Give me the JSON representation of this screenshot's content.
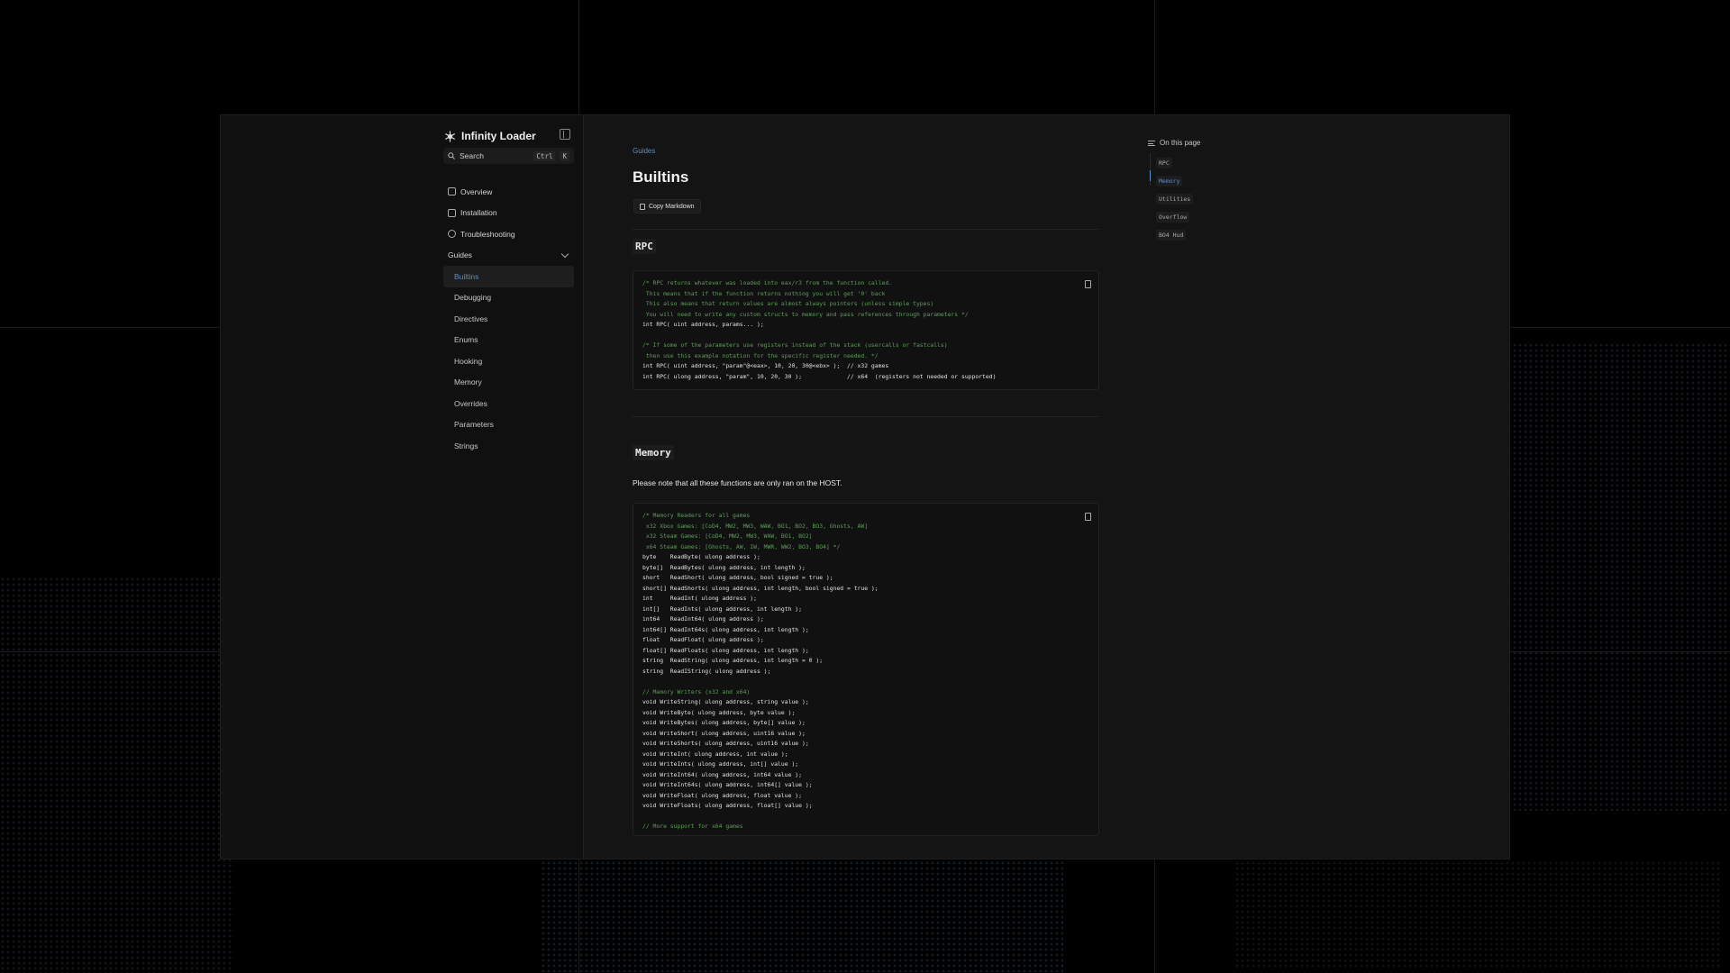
{
  "brand": {
    "name": "Infinity Loader"
  },
  "search": {
    "label": "Search",
    "key1": "Ctrl",
    "key2": "K"
  },
  "nav": {
    "overview": "Overview",
    "installation": "Installation",
    "troubleshooting": "Troubleshooting",
    "guides": "Guides",
    "guide_items": [
      "Builtins",
      "Debugging",
      "Directives",
      "Enums",
      "Hooking",
      "Memory",
      "Overrides",
      "Parameters",
      "Strings"
    ]
  },
  "main": {
    "breadcrumb": "Guides",
    "title": "Builtins",
    "copy_markdown": "Copy Markdown",
    "rpc_heading": "RPC",
    "memory_heading": "Memory",
    "memory_note": "Please note that all these functions are only ran on the HOST."
  },
  "code": {
    "rpc": [
      {
        "t": "/* RPC returns whatever was loaded into eax/r3 from the function called.",
        "c": true
      },
      {
        "t": " This means that if the function returns nothing you will get '0' back",
        "c": true
      },
      {
        "t": " This also means that return values are almost always pointers (unless simple types)",
        "c": true
      },
      {
        "t": " You will need to write any custom structs to memory and pass references through parameters */",
        "c": true
      },
      {
        "t": "int RPC( uint address, params... );",
        "c": false
      },
      {
        "t": "",
        "c": false
      },
      {
        "t": "/* If some of the parameters use registers instead of the stack (usercalls or fastcalls)",
        "c": true
      },
      {
        "t": " then use this example notation for the specific register needed. */",
        "c": true
      },
      {
        "t": "int RPC( uint address, \"param\"@<eax>, 10, 20, 30@<ebx> );  // x32 games",
        "c": false
      },
      {
        "t": "int RPC( ulong address, \"param\", 10, 20, 30 );             // x64  (registers not needed or supported)",
        "c": false
      }
    ],
    "memory": [
      {
        "t": "/* Memory Readers for all games",
        "c": true
      },
      {
        "t": " x32 Xbox Games: [CoD4, MW2, MW3, WAW, BO1, BO2, BO3, Ghosts, AW]",
        "c": true
      },
      {
        "t": " x32 Steam Games: [CoD4, MW2, MW3, WAW, BO1, BO2]",
        "c": true
      },
      {
        "t": " x64 Steam Games: [Ghosts, AW, IW, MWR, WW2, BO3, BO4] */",
        "c": true
      },
      {
        "t": "byte    ReadByte( ulong address );",
        "c": false
      },
      {
        "t": "byte[]  ReadBytes( ulong address, int length );",
        "c": false
      },
      {
        "t": "short   ReadShort( ulong address, bool signed = true );",
        "c": false
      },
      {
        "t": "short[] ReadShorts( ulong address, int length, bool signed = true );",
        "c": false
      },
      {
        "t": "int     ReadInt( ulong address );",
        "c": false
      },
      {
        "t": "int[]   ReadInts( ulong address, int length );",
        "c": false
      },
      {
        "t": "int64   ReadInt64( ulong address );",
        "c": false
      },
      {
        "t": "int64[] ReadInt64s( ulong address, int length );",
        "c": false
      },
      {
        "t": "float   ReadFloat( ulong address );",
        "c": false
      },
      {
        "t": "float[] ReadFloats( ulong address, int length );",
        "c": false
      },
      {
        "t": "string  ReadString( ulong address, int length = 0 );",
        "c": false
      },
      {
        "t": "string  ReadIString( ulong address );",
        "c": false
      },
      {
        "t": "",
        "c": false
      },
      {
        "t": "// Memory Writers (x32 and x64)",
        "c": true
      },
      {
        "t": "void WriteString( ulong address, string value );",
        "c": false
      },
      {
        "t": "void WriteByte( ulong address, byte value );",
        "c": false
      },
      {
        "t": "void WriteBytes( ulong address, byte[] value );",
        "c": false
      },
      {
        "t": "void WriteShort( ulong address, uint16 value );",
        "c": false
      },
      {
        "t": "void WriteShorts( ulong address, uint16 value );",
        "c": false
      },
      {
        "t": "void WriteInt( ulong address, int value );",
        "c": false
      },
      {
        "t": "void WriteInts( ulong address, int[] value );",
        "c": false
      },
      {
        "t": "void WriteInt64( ulong address, int64 value );",
        "c": false
      },
      {
        "t": "void WriteInt64s( ulong address, int64[] value );",
        "c": false
      },
      {
        "t": "void WriteFloat( ulong address, float value );",
        "c": false
      },
      {
        "t": "void WriteFloats( ulong address, float[] value );",
        "c": false
      },
      {
        "t": "",
        "c": false
      },
      {
        "t": "// More support for x64 games",
        "c": true
      }
    ]
  },
  "toc": {
    "title": "On this page",
    "items": [
      "RPC",
      "Memory",
      "Utilities",
      "Overflow",
      "BO4 Hud"
    ]
  },
  "colors": {
    "accent": "#5c8fc4",
    "comment": "#5e9d5a",
    "background": "#141414"
  }
}
